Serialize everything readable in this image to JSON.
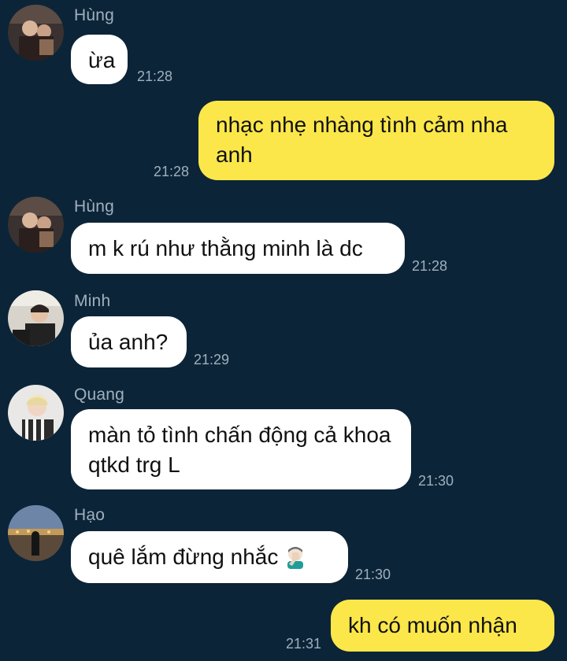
{
  "messages": [
    {
      "sender": "Hùng",
      "text": "ừa",
      "time": "21:28",
      "direction": "incoming"
    },
    {
      "text": "nhạc nhẹ nhàng tình cảm nha anh",
      "time": "21:28",
      "direction": "outgoing"
    },
    {
      "sender": "Hùng",
      "text": "m k rú như thằng minh là dc",
      "time": "21:28",
      "direction": "incoming"
    },
    {
      "sender": "Minh",
      "text": "ủa anh?",
      "time": "21:29",
      "direction": "incoming"
    },
    {
      "sender": "Quang",
      "text": "màn tỏ tình chấn động cả khoa qtkd trg L",
      "time": "21:30",
      "direction": "incoming"
    },
    {
      "sender": "Hạo",
      "text": "quê lắm đừng nhắc",
      "emoji": "man-facepalming-emoji",
      "time": "21:30",
      "direction": "incoming"
    },
    {
      "text": "kh có muốn nhận",
      "time": "21:31",
      "direction": "outgoing"
    }
  ],
  "colors": {
    "background": "#0c2438",
    "incoming_bubble": "#ffffff",
    "outgoing_bubble": "#fbe74a",
    "meta_text": "#9fb0bd"
  }
}
